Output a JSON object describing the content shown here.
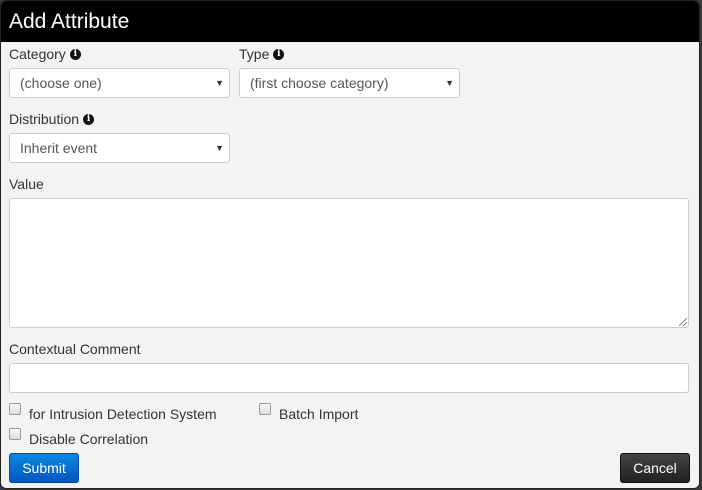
{
  "dialog": {
    "title": "Add Attribute"
  },
  "fields": {
    "category": {
      "label": "Category",
      "value": "(choose one)"
    },
    "type": {
      "label": "Type",
      "value": "(first choose category)"
    },
    "distribution": {
      "label": "Distribution",
      "value": "Inherit event"
    },
    "value": {
      "label": "Value",
      "content": ""
    },
    "comment": {
      "label": "Contextual Comment",
      "content": ""
    }
  },
  "checkboxes": {
    "ids": {
      "label": "for Intrusion Detection System",
      "checked": false
    },
    "batch": {
      "label": "Batch Import",
      "checked": false
    },
    "correlation": {
      "label": "Disable Correlation",
      "checked": false
    }
  },
  "buttons": {
    "submit": "Submit",
    "cancel": "Cancel"
  },
  "icons": {
    "info": "info-circle-icon",
    "caret": "caret-down-icon"
  },
  "colors": {
    "title_bg": "#000000",
    "submit_bg": "#0a6fd6",
    "cancel_bg": "#333333",
    "dialog_bg": "#f3f3f3"
  }
}
